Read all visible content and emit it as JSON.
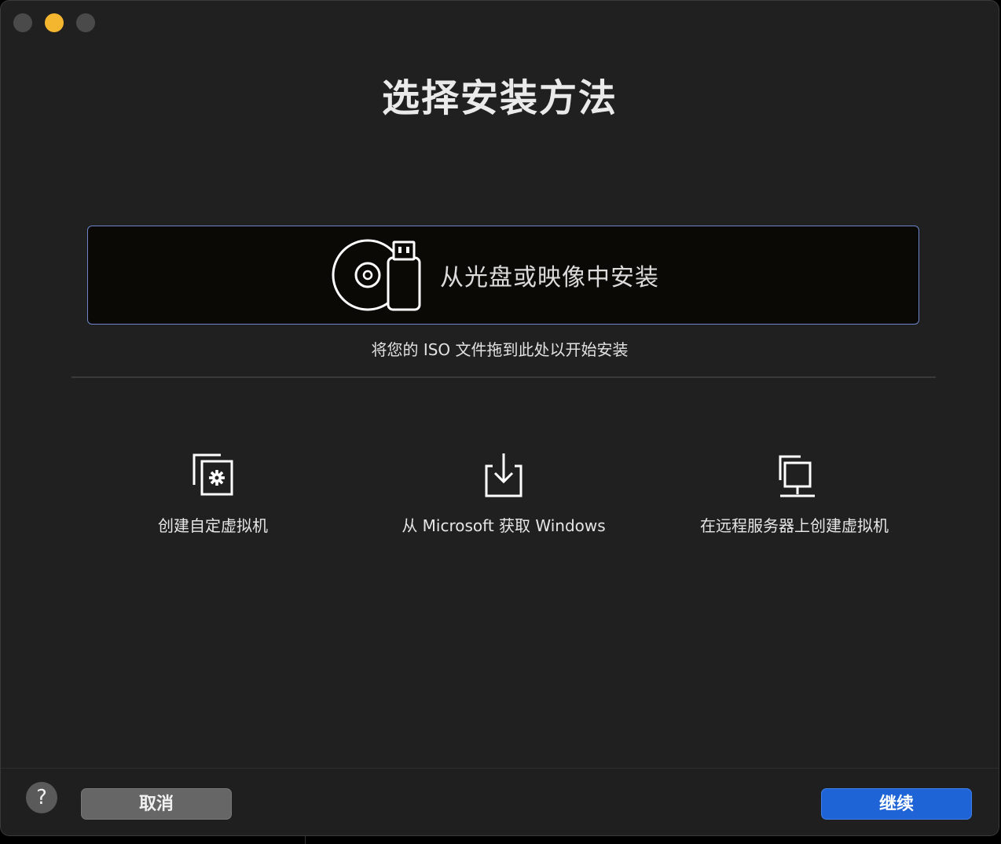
{
  "window": {
    "traffic_lights": [
      {
        "name": "close",
        "color": "#4a4a4a"
      },
      {
        "name": "minimize",
        "color": "#f5b62f"
      },
      {
        "name": "zoom",
        "color": "#4a4a4a"
      }
    ]
  },
  "main": {
    "title": "选择安装方法",
    "disc_option": {
      "label": "从光盘或映像中安装",
      "icon": "disc-usb-icon"
    },
    "drag_hint": "将您的 ISO 文件拖到此处以开始安装",
    "options": [
      {
        "id": "custom",
        "label": "创建自定虚拟机",
        "icon": "custom-vm-icon"
      },
      {
        "id": "microsoft",
        "label": "从 Microsoft 获取 Windows",
        "icon": "download-icon"
      },
      {
        "id": "remote",
        "label": "在远程服务器上创建虚拟机",
        "icon": "remote-server-icon"
      }
    ]
  },
  "footer": {
    "help_label": "?",
    "cancel_label": "取消",
    "continue_label": "继续"
  },
  "colors": {
    "accent": "#1e64d6",
    "selection_border": "#6e86c9"
  }
}
